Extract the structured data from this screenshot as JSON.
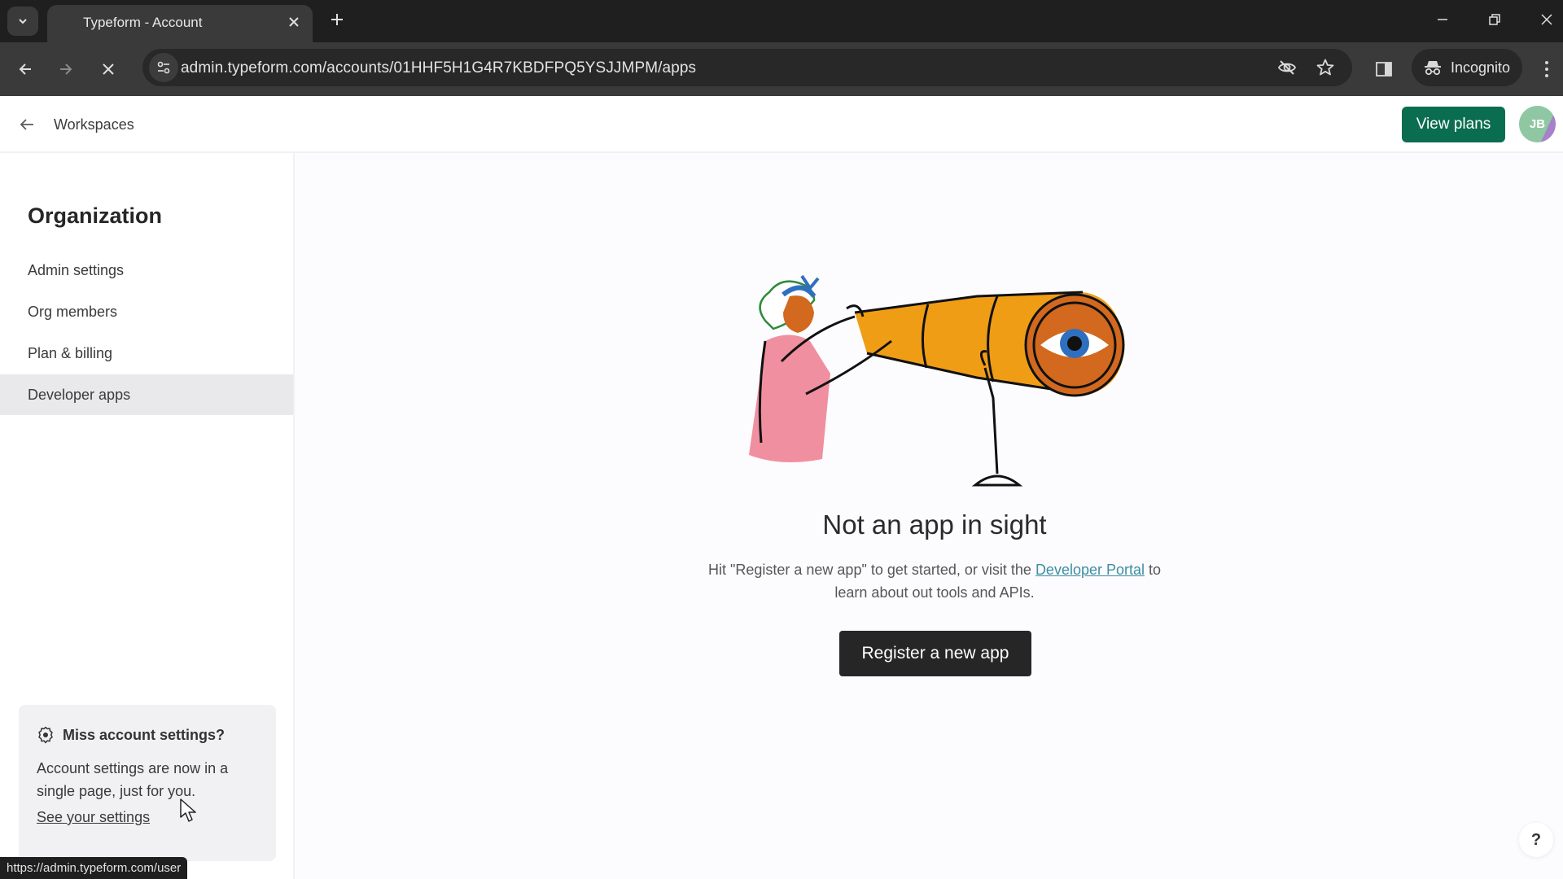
{
  "browser": {
    "tab_title": "Typeform - Account",
    "url": "admin.typeform.com/accounts/01HHF5H1G4R7KBDFPQ5YSJJMPM/apps",
    "incognito_label": "Incognito",
    "status_url": "https://admin.typeform.com/user",
    "icons": {
      "tab_search": "chevron-down-icon",
      "tab_close": "close-icon",
      "new_tab": "plus-icon",
      "back": "arrow-left-icon",
      "forward": "arrow-right-icon",
      "stop": "close-icon",
      "site_info": "tune-icon",
      "tracking": "eye-off-icon",
      "bookmark": "star-icon",
      "side_panel": "side-panel-icon",
      "incognito": "incognito-icon",
      "menu": "kebab-menu-icon"
    }
  },
  "header": {
    "back_label": "Workspaces",
    "view_plans_label": "View plans",
    "avatar_initials": "JB"
  },
  "sidebar": {
    "title": "Organization",
    "items": [
      {
        "label": "Admin settings",
        "active": false
      },
      {
        "label": "Org members",
        "active": false
      },
      {
        "label": "Plan & billing",
        "active": false
      },
      {
        "label": "Developer apps",
        "active": true
      }
    ],
    "promo": {
      "icon": "gear-icon",
      "title": "Miss account settings?",
      "body": "Account settings are now in a single page, just for you.",
      "link_label": "See your settings"
    }
  },
  "main": {
    "empty_title": "Not an app in sight",
    "desc_before": "Hit \"Register a new app\" to get started, or visit the ",
    "desc_link": "Developer Portal",
    "desc_after": " to learn about out tools and APIs.",
    "register_label": "Register a new app",
    "help_label": "?"
  },
  "colors": {
    "brand_green": "#0b6d4f",
    "primary_button": "#262627",
    "link": "#3c8fa3",
    "active_nav": "#e9e8eb"
  }
}
